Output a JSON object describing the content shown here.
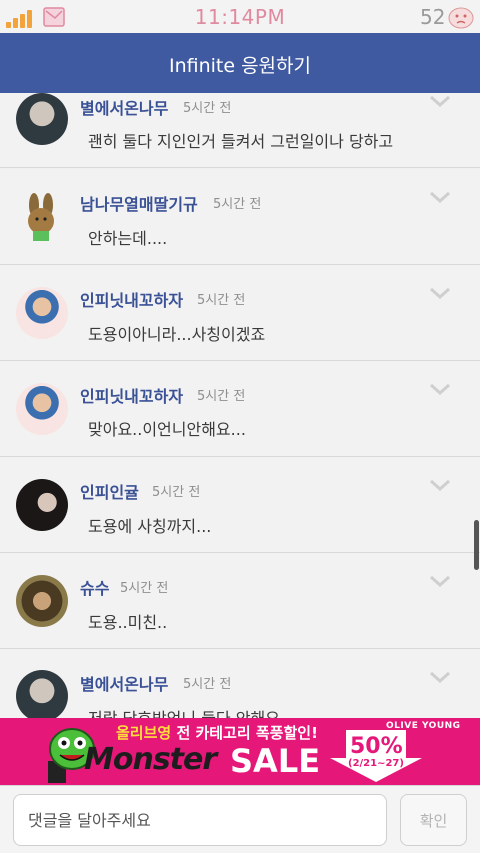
{
  "status_bar": {
    "time": "11:14PM",
    "battery": "52"
  },
  "header": {
    "title": "Infinite 응원하기"
  },
  "comments": [
    {
      "name": "별에서온나무",
      "time": "5시간 전",
      "text": "괜히 둘다 지인인거 들켜서 그런일이나 당하고",
      "avatar_color": "#3a4a4f"
    },
    {
      "name": "남나무열매딸기규",
      "time": "5시간 전",
      "text": "안하는데....",
      "avatar_color": "#8a6a3a"
    },
    {
      "name": "인피닛내꼬하자",
      "time": "5시간 전",
      "text": "도용이아니라...사칭이겠죠",
      "avatar_color": "#f3d9d6"
    },
    {
      "name": "인피닛내꼬하자",
      "time": "5시간 전",
      "text": "맞아요..이언니안해요...",
      "avatar_color": "#f3d9d6"
    },
    {
      "name": "인피인귤",
      "time": "5시간 전",
      "text": "도용에 사칭까지...",
      "avatar_color": "#1e1a1a"
    },
    {
      "name": "슈수",
      "time": "5시간 전",
      "text": "도용..미친..",
      "avatar_color": "#6a5a3a"
    },
    {
      "name": "별에서온나무",
      "time": "5시간 전",
      "text": "저랑 당호박언니 둘다 안해요",
      "avatar_color": "#3a4a4f"
    }
  ],
  "ad": {
    "brand_korean": "올리브영",
    "headline": "전 카테고리 폭풍할인!",
    "monster": "Monster",
    "sale": "SALE",
    "brand": "OLIVE YOUNG",
    "percent": "50%",
    "dates": "(2/21~27)",
    "accent_color": "#e5187a"
  },
  "input": {
    "placeholder": "댓글을 달아주세요",
    "confirm_label": "확인"
  }
}
